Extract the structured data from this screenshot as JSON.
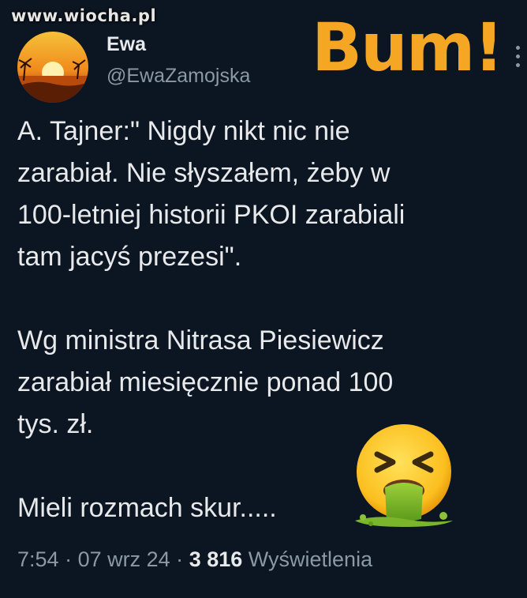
{
  "watermark": "www.wiocha.pl",
  "sticker": "Bum!",
  "author": {
    "name": "Ewa",
    "handle": "@EwaZamojska"
  },
  "tweet": {
    "paragraph1": "A. Tajner:\" Nigdy nikt nic nie\nzarabiał. Nie słyszałem, żeby w\n100-letniej historii PKOI  zarabiali\ntam jacyś prezesi\".",
    "paragraph2": "Wg ministra Nitrasa Piesiewicz\nzarabiał miesięcznie ponad 100\ntys. zł.",
    "paragraph3": "Mieli rozmach skur....."
  },
  "meta": {
    "time": "7:54",
    "sep1": "·",
    "date": "07 wrz 24",
    "sep2": "·",
    "views_count": "3 816",
    "views_label": "Wyświetlenia"
  },
  "icons": {
    "avatar": "sunset-avatar",
    "emoji": "vomiting-face-emoji",
    "more": "more-icon"
  },
  "colors": {
    "background": "#0c1522",
    "text": "#e7e9ea",
    "secondary": "#8b98a5",
    "sticker": "#f5a623"
  }
}
